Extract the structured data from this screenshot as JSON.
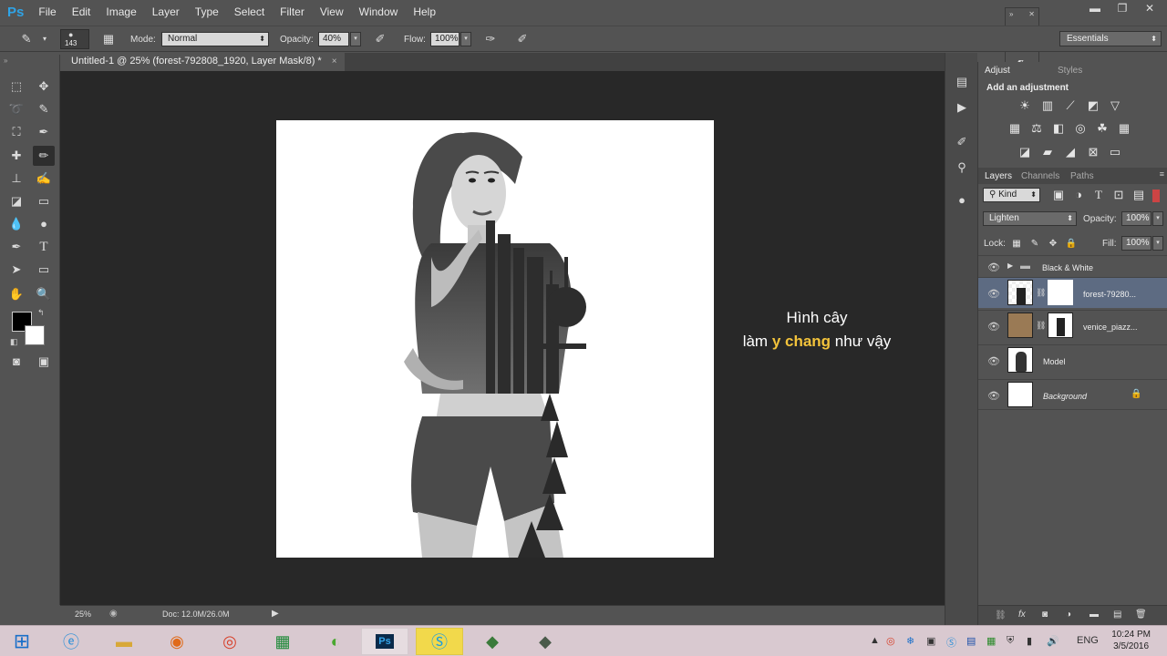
{
  "app": {
    "logo": "Ps"
  },
  "menu": [
    "File",
    "Edit",
    "Image",
    "Layer",
    "Type",
    "Select",
    "Filter",
    "View",
    "Window",
    "Help"
  ],
  "window_controls": {
    "minimize": "▬",
    "restore": "❐",
    "close": "✕"
  },
  "options": {
    "brush_size": "143",
    "mode_label": "Mode:",
    "mode_value": "Normal",
    "opacity_label": "Opacity:",
    "opacity_value": "40%",
    "flow_label": "Flow:",
    "flow_value": "100%"
  },
  "workspace": {
    "value": "Essentials"
  },
  "document": {
    "tab_title": "Untitled-1 @ 25% (forest-792808_1920, Layer Mask/8) *",
    "close": "×",
    "zoom": "25%",
    "doc_size": "Doc: 12.0M/26.0M"
  },
  "caption": {
    "line1": "Hình cây",
    "line2_prefix": "làm ",
    "line2_highlight": "y chang",
    "line2_suffix": " như vậy"
  },
  "adjustments": {
    "tab_adjustments": "Adjust",
    "tab_styles": "Styles",
    "heading": "Add an adjustment"
  },
  "layers_panel": {
    "tabs": [
      "Layers",
      "Channels",
      "Paths"
    ],
    "filter_label": "Kind",
    "blend_mode": "Lighten",
    "opacity_label": "Opacity:",
    "opacity_value": "100%",
    "lock_label": "Lock:",
    "fill_label": "Fill:",
    "fill_value": "100%",
    "layers": [
      {
        "name": "Black & White",
        "type": "group"
      },
      {
        "name": "forest-79280...",
        "type": "masked",
        "selected": true
      },
      {
        "name": "venice_piazz...",
        "type": "masked"
      },
      {
        "name": "Model",
        "type": "plain"
      },
      {
        "name": "Background",
        "type": "background",
        "locked": true
      }
    ]
  },
  "taskbar": {
    "lang": "ENG",
    "time": "10:24 PM",
    "date": "3/5/2016"
  },
  "colors": {
    "accent_highlight": "#f3c33b",
    "selected_layer": "#5d6b82",
    "ps_blue": "#2fa3e6"
  }
}
